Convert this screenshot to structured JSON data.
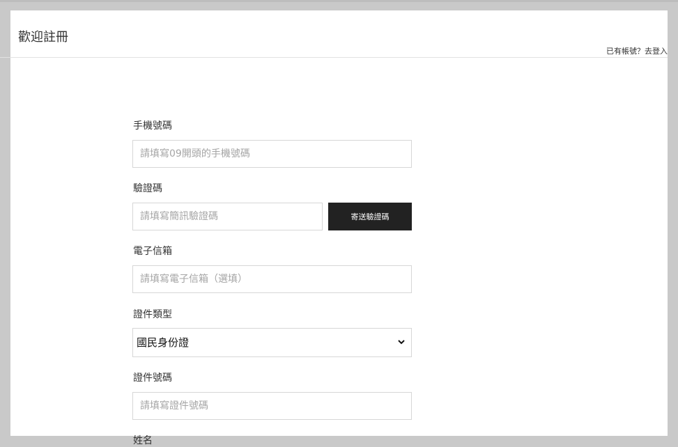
{
  "header": {
    "title": "歡迎註冊",
    "login_link": "已有帳號？去登入"
  },
  "form": {
    "phone": {
      "label": "手機號碼",
      "placeholder": "請填寫09開頭的手機號碼"
    },
    "code": {
      "label": "驗證碼",
      "placeholder": "請填寫簡訊驗證碼",
      "send_button": "寄送驗證碼"
    },
    "email": {
      "label": "電子信箱",
      "placeholder": "請填寫電子信箱（選填）"
    },
    "id_type": {
      "label": "證件類型",
      "selected": "國民身份證"
    },
    "id_number": {
      "label": "證件號碼",
      "placeholder": "請填寫證件號碼"
    },
    "name": {
      "label": "姓名"
    }
  },
  "icons": {
    "select_arrow": "chevron-down-icon"
  },
  "colors": {
    "button_bg": "#222222",
    "overlay": "#c9c9c9",
    "border": "#d6d6d6"
  }
}
